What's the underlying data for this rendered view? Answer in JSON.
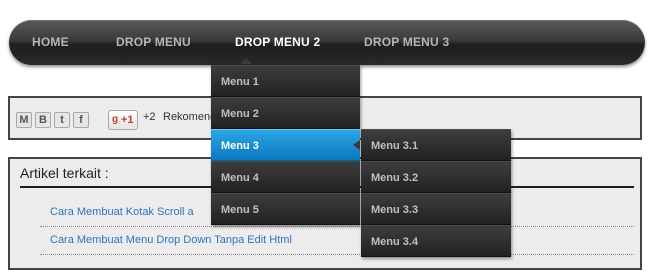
{
  "nav": {
    "items": [
      "HOME",
      "DROP MENU",
      "DROP MENU 2",
      "DROP MENU 3"
    ],
    "active_index": 2
  },
  "dropdown": {
    "items": [
      "Menu 1",
      "Menu 2",
      "Menu 3",
      "Menu 4",
      "Menu 5"
    ],
    "active_index": 2
  },
  "submenu": {
    "items": [
      "Menu 3.1",
      "Menu 3.2",
      "Menu 3.3",
      "Menu 3.4"
    ]
  },
  "share": {
    "buttons": [
      {
        "icon": "gmail-icon",
        "glyph": "M"
      },
      {
        "icon": "blogger-icon",
        "glyph": "B"
      },
      {
        "icon": "twitter-icon",
        "glyph": "t"
      },
      {
        "icon": "facebook-icon",
        "glyph": "f"
      }
    ],
    "gplus_g": "g",
    "gplus_label": "+1",
    "count": "+2",
    "recommend_text": "Rekomenda"
  },
  "related": {
    "title": "Artikel terkait :",
    "links": [
      "Cara Membuat Kotak Scroll a",
      "Cara Membuat Menu Drop Down Tanpa Edit Html"
    ]
  },
  "colors": {
    "accent": "#1a90d6",
    "link": "#2e73c0",
    "nav_dark": "#2a2a2a"
  }
}
